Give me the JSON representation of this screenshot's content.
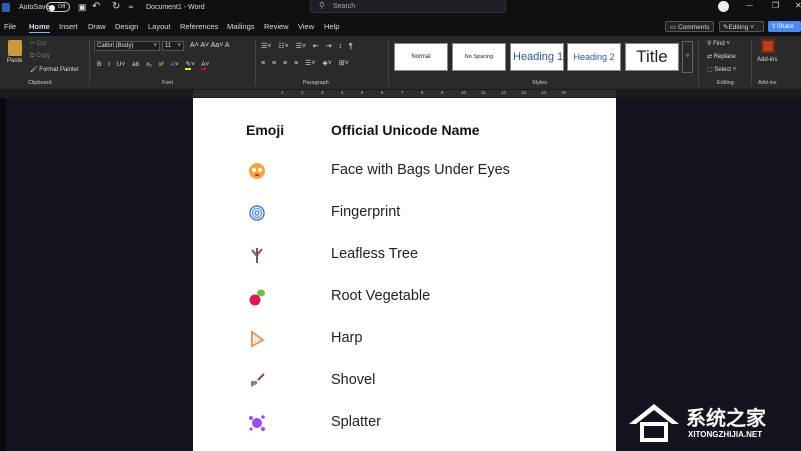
{
  "titlebar": {
    "autosave": "AutoSave",
    "toggle": "Off",
    "doc_title": "Document1  -  Word",
    "search_placeholder": "Search"
  },
  "tabs": [
    "File",
    "Home",
    "Insert",
    "Draw",
    "Design",
    "Layout",
    "References",
    "Mailings",
    "Review",
    "View",
    "Help"
  ],
  "actions": {
    "comments": "Comments",
    "editing": "Editing",
    "share": "Share"
  },
  "ribbon": {
    "clipboard": {
      "paste": "Paste",
      "cut": "Cut",
      "copy": "Copy",
      "format_painter": "Format Painter",
      "label": "Clipboard"
    },
    "font": {
      "name": "Calibri (Body)",
      "size": "11",
      "label": "Font"
    },
    "paragraph": {
      "label": "Paragraph"
    },
    "styles": {
      "items": [
        "Normal",
        "No Spacing",
        "Heading 1",
        "Heading 2",
        "Title"
      ],
      "label": "Styles"
    },
    "editing": {
      "find": "Find",
      "replace": "Replace",
      "select": "Select",
      "label": "Editing"
    },
    "addins": {
      "button": "Add-ins",
      "label": "Add-ins"
    }
  },
  "ruler_numbers": [
    "1",
    "2",
    "3",
    "4",
    "5",
    "6",
    "7",
    "8",
    "9",
    "10",
    "11",
    "12",
    "13",
    "14",
    "15"
  ],
  "document": {
    "headers": [
      "Emoji",
      "Official Unicode Name"
    ],
    "rows": [
      {
        "emoji": "face-with-bags-under-eyes",
        "name": "Face with Bags Under Eyes"
      },
      {
        "emoji": "fingerprint",
        "name": "Fingerprint"
      },
      {
        "emoji": "leafless-tree",
        "name": "Leafless Tree"
      },
      {
        "emoji": "root-vegetable",
        "name": "Root Vegetable"
      },
      {
        "emoji": "harp",
        "name": "Harp"
      },
      {
        "emoji": "shovel",
        "name": "Shovel"
      },
      {
        "emoji": "splatter",
        "name": "Splatter"
      }
    ]
  },
  "watermark": {
    "cn": "系统之家",
    "url": "XITONGZHIJIA.NET"
  },
  "colors": {
    "accent": "#4a8af4",
    "page": "#ffffff",
    "background": "#14141f"
  }
}
